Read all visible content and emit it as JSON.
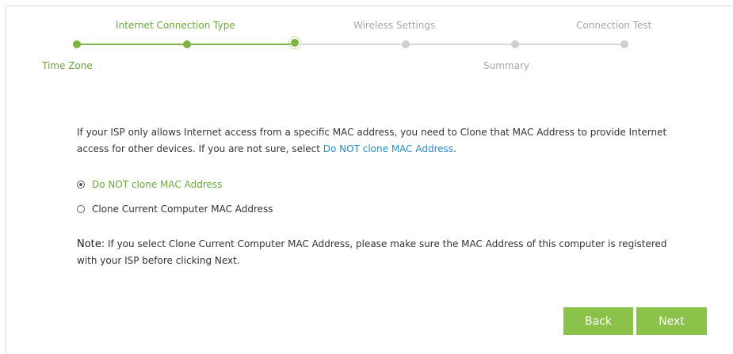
{
  "steps": {
    "internet_connection_type": "Internet Connection Type",
    "wireless_settings": "Wireless Settings",
    "connection_test": "Connection Test",
    "time_zone": "Time Zone",
    "summary": "Summary",
    "current_step": "Internet Connection Type"
  },
  "colors": {
    "active": "#7cb342",
    "inactive": "#cfcfcf",
    "link": "#2a8ac7",
    "button": "#8bc34a"
  },
  "content": {
    "description_prefix": "If your ISP only allows Internet access from a specific MAC address, you need to Clone that MAC Address to provide Internet access for other devices. If you are not sure, select ",
    "description_link": "Do NOT clone MAC Address",
    "description_suffix": ".",
    "options": [
      {
        "label": "Do NOT clone MAC Address",
        "selected": true
      },
      {
        "label": "Clone Current Computer MAC Address",
        "selected": false
      }
    ],
    "note_label": "Note:",
    "note_text": " If you select Clone Current Computer MAC Address, please make sure the MAC Address of this computer is registered with your ISP before clicking Next."
  },
  "buttons": {
    "back": "Back",
    "next": "Next"
  }
}
